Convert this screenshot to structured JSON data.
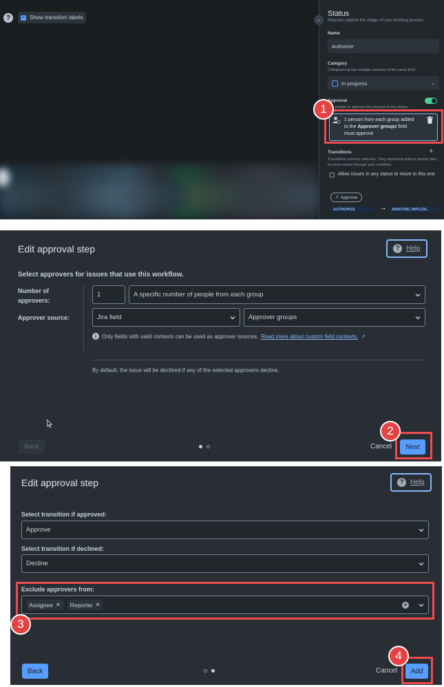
{
  "panel1": {
    "toolbar": {
      "help_icon": "question-icon",
      "show_labels": "Show transition labels"
    },
    "status": {
      "title": "Status",
      "subtitle": "Statuses capture the stages of your working process.",
      "name_label": "Name",
      "name_value": "Authorize",
      "category_label": "Category",
      "category_help": "Categories group multiple statuses of the same kind.",
      "category_value": "In progress",
      "approval_label": "Approval",
      "approval_help": "Ask people to approve the request at this status.",
      "approver_line1": "1 person from each group added",
      "approver_line2_pre": "to the ",
      "approver_line2_bold": "Approver groups",
      "approver_line2_post": " field",
      "approver_line3": "must approve",
      "transitions_label": "Transitions",
      "transitions_help": "Transitions connect statuses. They represent actions people take to move issues through your workflow.",
      "allow_any": "Allow issues in any status to move to this one",
      "approve_transition": "Approve",
      "from_status": "AUTHORIZE",
      "to_status": "AWAITING IMPLEM..."
    }
  },
  "panel2": {
    "title": "Edit approval step",
    "help": "Help",
    "intro": "Select approvers for issues that use this workflow.",
    "num_label_1": "Number of",
    "num_label_2": "approvers:",
    "num_value": "1",
    "num_mode": "A specific number of people from each group",
    "source_label": "Approver source:",
    "source_value": "Jira field",
    "source_field": "Approver groups",
    "info_text": "Only fields with valid contexts can be used as approver sources.",
    "info_link": "Read more about custom field contexts.",
    "decline_note": "By default, the issue will be declined if any of the selected approvers decline.",
    "back": "Back",
    "cancel": "Cancel",
    "next": "Next"
  },
  "panel3": {
    "title": "Edit approval step",
    "help": "Help",
    "approved_label": "Select transition if approved:",
    "approved_value": "Approve",
    "declined_label": "Select transition if declined:",
    "declined_value": "Decline",
    "exclude_label": "Exclude approvers from:",
    "exclude_tags": [
      "Assignee",
      "Reporter"
    ],
    "back": "Back",
    "cancel": "Cancel",
    "add": "Add"
  },
  "badges": [
    "1",
    "2",
    "3",
    "4"
  ],
  "colors": {
    "accent": "#579dff",
    "highlight": "#ef4d4d",
    "surface": "#282e33"
  }
}
